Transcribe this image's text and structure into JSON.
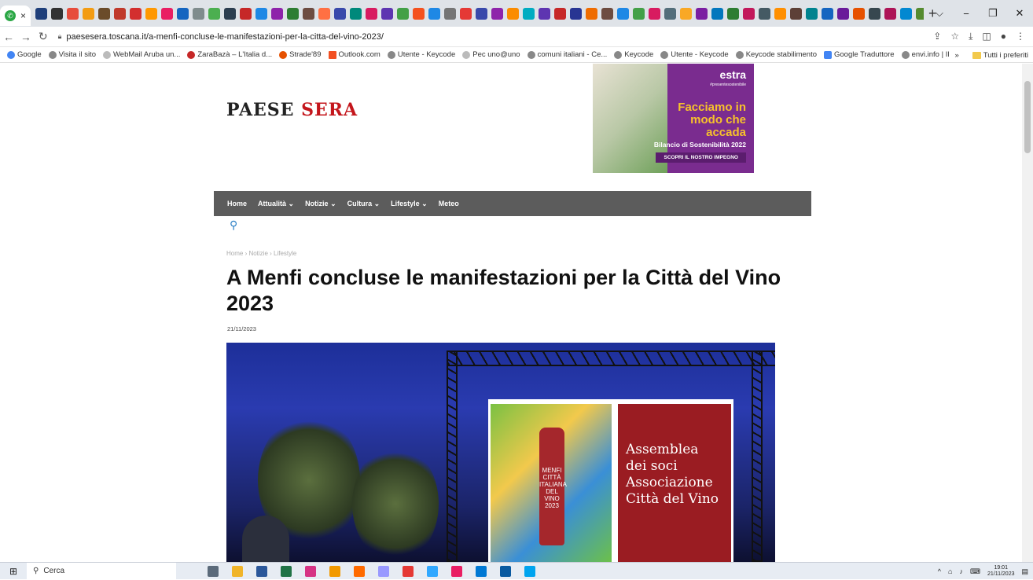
{
  "browser": {
    "tab_close": "×",
    "new_tab": "+",
    "url": "paesesera.toscana.it/a-menfi-concluse-le-manifestazioni-per-la-citta-del-vino-2023/",
    "window_controls": [
      "⌵",
      "−",
      "❐",
      "✕"
    ],
    "pinned_colors": [
      "#1f3f7a",
      "#333",
      "#e74c3c",
      "#f39c12",
      "#6b4c2a",
      "#c0392b",
      "#d32f2f",
      "#ff9800",
      "#e91e63",
      "#1565c0",
      "#7f8c8d",
      "#4caf50",
      "#2c3e50",
      "#c62828",
      "#1e88e5",
      "#8e24aa",
      "#2e7d32",
      "#6d4c41",
      "#ff7043",
      "#3949ab",
      "#00897b",
      "#d81b60",
      "#5e35b1",
      "#43a047",
      "#f4511e",
      "#1e88e5",
      "#757575",
      "#e53935",
      "#3949ab",
      "#8e24aa",
      "#fb8c00",
      "#00acc1",
      "#5e35b1",
      "#c62828",
      "#283593",
      "#ef6c00",
      "#6d4c41",
      "#1e88e5",
      "#43a047",
      "#d81b60",
      "#546e7a",
      "#f9a825",
      "#7b1fa2",
      "#0277bd",
      "#2e7d32",
      "#c2185b",
      "#455a64",
      "#ff8f00",
      "#5d4037",
      "#00838f",
      "#1565c0",
      "#6a1b9a",
      "#e65100",
      "#37474f",
      "#ad1457",
      "#0288d1",
      "#558b2f",
      "#4e342e",
      "#f57f17",
      "#1a237e",
      "#bf360c",
      "#311b92",
      "#004d40",
      "#880e4f"
    ]
  },
  "bookmarks": [
    "Google",
    "Visita il sito",
    "WebMail Aruba un...",
    "ZaraBazà – L'Italia d...",
    "Strade'89",
    "Outlook.com",
    "Utente - Keycode",
    "Pec uno@uno",
    "comuni italiani - Ce...",
    "Keycode",
    "Utente - Keycode",
    "Keycode stabilimento",
    "Google Traduttore",
    "envi.info | Il portale..."
  ],
  "bookmarks_more": "»",
  "bookmarks_folder": "Tutti i preferiti",
  "site": {
    "logo_part1": "PAESE ",
    "logo_part2": "SERA",
    "ad": {
      "brand": "estra",
      "tag": "#presentesostenibile",
      "headline": "Facciamo in modo che accada",
      "subtitle": "Bilancio di Sostenibilità 2022",
      "cta": "SCOPRI IL NOSTRO IMPEGNO"
    },
    "menu": [
      "Home",
      "Attualità ⌄",
      "Notizie ⌄",
      "Cultura ⌄",
      "Lifestyle ⌄",
      "Meteo"
    ],
    "breadcrumb": "Home › Notizie › Lifestyle",
    "title": "A Menfi concluse le manifestazioni per la Città del Vino 2023",
    "date": "21/11/2023",
    "photo_banner_lines": [
      "Assemblea",
      "dei soci",
      "Associazione",
      "Città del Vino"
    ],
    "photo_bottle_text": "MENFI CITTÀ ITALIANA DEL VINO 2023"
  },
  "taskbar": {
    "search": "Cerca",
    "time": "19:01",
    "date": "21/11/2023",
    "app_colors": [
      "#5b6a7a",
      "#f0b429",
      "#2b579a",
      "#217346",
      "#d63384",
      "#f29900",
      "#ff6a00",
      "#9999ff",
      "#e53935",
      "#31a8ff",
      "#e91e63",
      "#0078d4",
      "#0a5aa0",
      "#00a4ef"
    ]
  }
}
